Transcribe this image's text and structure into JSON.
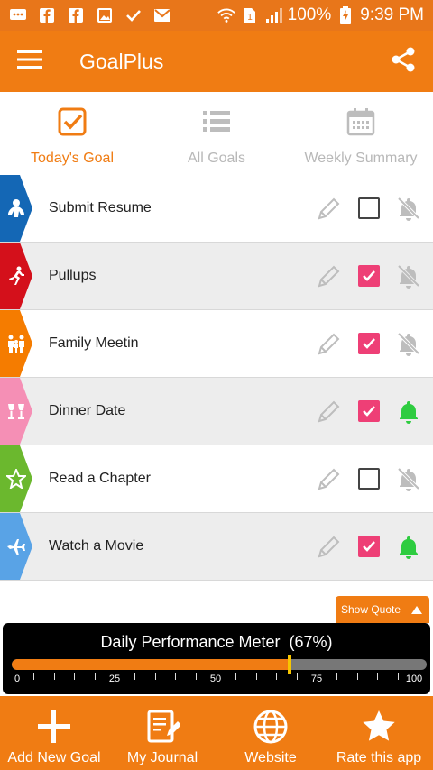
{
  "status_bar": {
    "battery": "100%",
    "time": "9:39 PM",
    "left_icons": [
      "message-icon",
      "facebook-icon",
      "facebook-icon",
      "image-icon",
      "check-icon",
      "mail-icon"
    ]
  },
  "app_bar": {
    "title": "GoalPlus"
  },
  "tabs": [
    {
      "label": "Today's Goal",
      "icon": "checkbox-icon",
      "active": true
    },
    {
      "label": "All Goals",
      "icon": "list-icon",
      "active": false
    },
    {
      "label": "Weekly Summary",
      "icon": "calendar-icon",
      "active": false
    }
  ],
  "goals": [
    {
      "name": "Submit Resume",
      "badge_color": "#1467b5",
      "badge_icon": "person-icon",
      "checked": false,
      "reminder": false
    },
    {
      "name": "Pullups",
      "badge_color": "#d4101b",
      "badge_icon": "runner-icon",
      "checked": true,
      "reminder": false
    },
    {
      "name": "Family Meetin",
      "badge_color": "#f57c00",
      "badge_icon": "family-icon",
      "checked": true,
      "reminder": false
    },
    {
      "name": "Dinner Date",
      "badge_color": "#f58fb5",
      "badge_icon": "glasses-icon",
      "checked": true,
      "reminder": true
    },
    {
      "name": "Read a Chapter",
      "badge_color": "#6bb82e",
      "badge_icon": "star-icon",
      "checked": false,
      "reminder": false
    },
    {
      "name": "Watch a Movie",
      "badge_color": "#59a3e6",
      "badge_icon": "plane-icon",
      "checked": true,
      "reminder": true
    }
  ],
  "colors": {
    "accent": "#f07c13",
    "checked": "#ee3f76",
    "bell_on": "#2ecc40",
    "bell_off": "#bdbdbd"
  },
  "quote_button": {
    "label": "Show Quote"
  },
  "meter": {
    "title": "Daily Performance Meter",
    "percent_text": "(67%)",
    "value": 67,
    "scale_labels": [
      "0",
      "25",
      "50",
      "75",
      "100"
    ]
  },
  "bottom_nav": [
    {
      "label": "Add New Goal",
      "icon": "plus-icon"
    },
    {
      "label": "My Journal",
      "icon": "journal-icon"
    },
    {
      "label": "Website",
      "icon": "globe-icon"
    },
    {
      "label": "Rate this app",
      "icon": "star-icon"
    }
  ]
}
